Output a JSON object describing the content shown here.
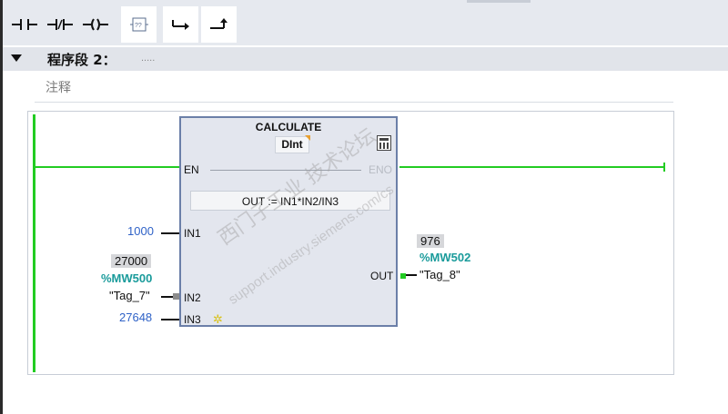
{
  "toolbar": {
    "buttons": [
      {
        "name": "no-contact"
      },
      {
        "name": "nc-contact"
      },
      {
        "name": "coil"
      },
      {
        "name": "empty-box"
      },
      {
        "name": "open-branch"
      },
      {
        "name": "close-branch"
      }
    ]
  },
  "network": {
    "title": "程序段 2：",
    "title_dots": ".....",
    "comment": "注释"
  },
  "block": {
    "title": "CALCULATE",
    "data_type": "DInt",
    "en": "EN",
    "eno": "ENO",
    "expression": "OUT :=   IN1*IN2/IN3",
    "in1": "IN1",
    "in2": "IN2",
    "in3": "IN3",
    "out": "OUT"
  },
  "operands": {
    "in1_value": "1000",
    "in2_value": "27000",
    "in2_address": "%MW500",
    "in2_tag": "\"Tag_7\"",
    "in3_value": "27648",
    "out_value": "976",
    "out_address": "%MW502",
    "out_tag": "\"Tag_8\""
  },
  "watermark": {
    "line1": "西门子工业 技术论坛",
    "line2": "support.industry.siemens.com/cs"
  },
  "colors": {
    "rail": "#22cc22",
    "constant": "#2f62c7",
    "address": "#1a9b9b",
    "block_border": "#6b7fa8"
  }
}
